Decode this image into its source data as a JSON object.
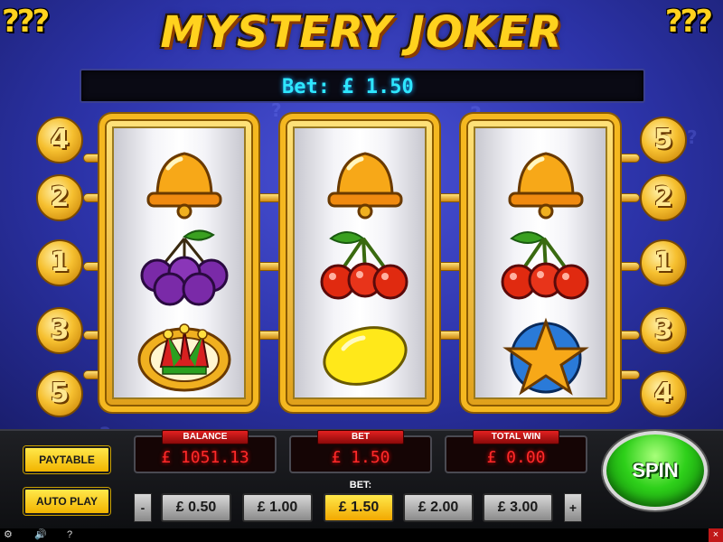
{
  "game": {
    "title": "MYSTERY JOKER",
    "corner_decoration": "???"
  },
  "bet_display": "Bet: £ 1.50",
  "reels": [
    {
      "symbols": [
        "bell",
        "plum",
        "joker-hat"
      ]
    },
    {
      "symbols": [
        "bell",
        "cherry",
        "lemon"
      ]
    },
    {
      "symbols": [
        "bell",
        "cherry",
        "star"
      ]
    }
  ],
  "paylines": {
    "left": [
      "4",
      "2",
      "1",
      "3",
      "5"
    ],
    "right": [
      "5",
      "2",
      "1",
      "3",
      "4"
    ]
  },
  "meters": {
    "balance_label": "BALANCE",
    "balance_value": "£ 1051.13",
    "bet_label": "BET",
    "bet_value": "£ 1.50",
    "win_label": "TOTAL WIN",
    "win_value": "£ 0.00"
  },
  "buttons": {
    "paytable": "PAYTABLE",
    "autoplay": "AUTO PLAY",
    "spin": "SPIN",
    "decrease": "-",
    "increase": "+"
  },
  "bet_selector": {
    "label": "BET:",
    "options": [
      "£ 0.50",
      "£ 1.00",
      "£ 1.50",
      "£ 2.00",
      "£ 3.00"
    ],
    "selected": "£ 1.50"
  },
  "toolbar": {
    "settings_icon": "gear-icon",
    "sound_icon": "speaker-icon",
    "help_label": "?",
    "close_label": "×"
  },
  "colors": {
    "accent_gold": "#f5b820",
    "spin_green": "#2ed01a",
    "meter_red": "#ff2a2a",
    "bet_cyan": "#2ee6ff"
  }
}
